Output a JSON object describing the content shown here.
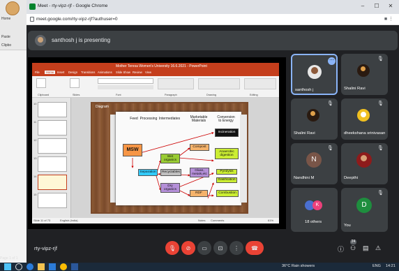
{
  "chrome": {
    "window_title": "Meet - rty-vipz-rjf - Google Chrome",
    "url": "meet.google.com/rty-vipz-rjf?authuser=0"
  },
  "background_app": {
    "labels": [
      "Home",
      "Paste",
      "Clipbo"
    ]
  },
  "presenting_banner": "santhosh j is presenting",
  "powerpoint": {
    "title": "Mother Teresa Women's University 16.6.2021 - PowerPoint",
    "tabs": [
      "File",
      "Home",
      "Insert",
      "Design",
      "Transitions",
      "Animations",
      "Slide Show",
      "Review",
      "View"
    ],
    "ribbon_groups": [
      "Clipboard",
      "Slides",
      "Font",
      "Paragraph",
      "Drawing",
      "Editing"
    ],
    "status_left": "Slide 11 of 73",
    "status_lang": "English (India)",
    "status_right": "Notes",
    "status_comments": "Comments",
    "zoom": "61%",
    "thumb_numbers": [
      "10",
      "11",
      "12",
      "13",
      "14",
      "15"
    ],
    "slide_tag": "Diagram"
  },
  "diagram": {
    "headers": [
      "Feed",
      "Processing",
      "Intermediates",
      "Marketable\nMaterials",
      "Conversion\nto Energy"
    ],
    "nodes": {
      "msw": "MSW",
      "separation": "Separation",
      "wet_organics": "Wet\norganics",
      "recyclables": "Recyclables",
      "dry_organics": "Dry\norganics",
      "compost": "Compost",
      "glass": "Glass,\nmetals,etc",
      "rdf": "RDF",
      "incineration": "Incineration",
      "anaerobic": "Anaerobic\ndigestion",
      "pyrolysis": "Pyrolysis",
      "gasification": "Gasification",
      "combustion": "Combustion"
    },
    "colors": {
      "msw": "#f79646",
      "separation": "#33ccff",
      "wet": "#99cc33",
      "recyclables": "#c0c0c0",
      "dry": "#b48fd8",
      "compost": "#f5b36b",
      "glass": "#b48fd8",
      "rdf": "#f5b36b",
      "incineration": "#111111",
      "anaerobic": "#ccee33",
      "pyrolysis": "#ccee33",
      "gasification": "#ccee33",
      "combustion": "#ccee33"
    }
  },
  "participants": [
    {
      "name": "santhosh j",
      "kind": "photo",
      "active": true
    },
    {
      "name": "Shalini Ravi",
      "kind": "photo",
      "muted": true
    },
    {
      "name": "Shalini Ravi",
      "kind": "photo",
      "muted": true
    },
    {
      "name": "dheekshana srinivasan",
      "kind": "photo",
      "muted": true
    },
    {
      "name": "Nandhini M",
      "kind": "initial",
      "initial": "N",
      "color": "#795548",
      "muted": true
    },
    {
      "name": "Deepthi",
      "kind": "photo",
      "muted": true
    },
    {
      "name": "18 others",
      "kind": "group",
      "initial": "K"
    },
    {
      "name": "You",
      "kind": "initial",
      "initial": "D",
      "color": "#1e8e3e",
      "muted": true
    }
  ],
  "meeting_code": "rty-vipz-rjf",
  "right_badge": "24",
  "page_label": "Page 1 of 1",
  "taskbar": {
    "weather": "36°C  Rain showers",
    "time": "14:21",
    "lang": "ENG"
  },
  "accent": "#8ab4f8"
}
